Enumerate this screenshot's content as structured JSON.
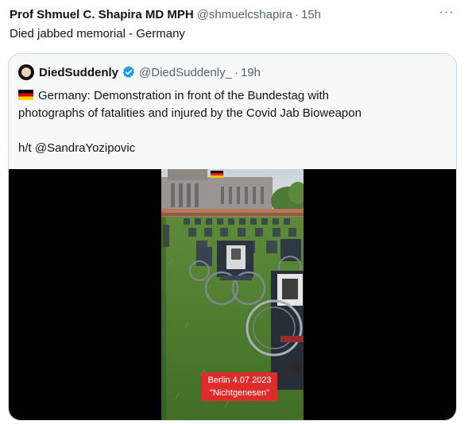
{
  "tweet": {
    "author_name": "Prof Shmuel C. Shapira MD MPH",
    "author_handle": "@shmuelcshapira",
    "separator": "·",
    "time": "15h",
    "more_icon": "···",
    "text": "Died jabbed memorial - Germany"
  },
  "quoted_tweet": {
    "author_name": "DiedSuddenly",
    "author_handle": "@DiedSuddenly_",
    "separator": "·",
    "time": "19h",
    "text_line1": "Germany:  Demonstration in front of the Bundestag with",
    "text_line2": "photographs of fatalities and injured by the Covid Jab Bioweapon",
    "hat_tip": "h/t @SandraYozipovic",
    "flag_icon": "germany-flag-icon",
    "verified_icon": "verified-badge-icon",
    "verified_color": "#1d9bf0"
  },
  "media": {
    "caption_line1": "Berlin 4.07.2023",
    "caption_line2": "\"Nichtgenesen\"",
    "caption_color": "#e02b2b"
  }
}
